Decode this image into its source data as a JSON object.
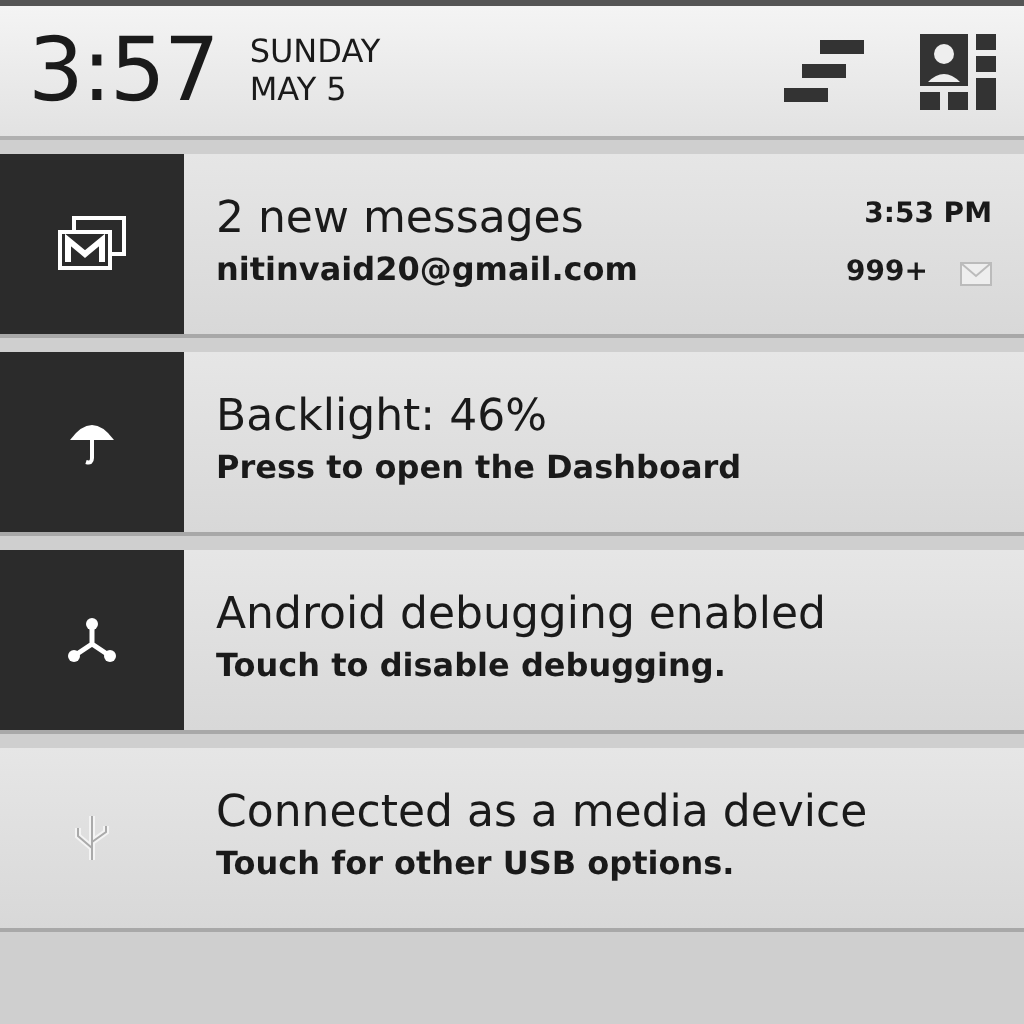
{
  "header": {
    "time": "3:57",
    "day": "SUNDAY",
    "date": "MAY 5"
  },
  "notifications": [
    {
      "kind": "mail",
      "dark_icon": true,
      "title": "2 new messages",
      "subtitle": "nitinvaid20@gmail.com",
      "time": "3:53 PM",
      "count": "999+"
    },
    {
      "kind": "umbrella",
      "dark_icon": true,
      "title": "Backlight: 46%",
      "subtitle": "Press to open the Dashboard"
    },
    {
      "kind": "debug",
      "dark_icon": true,
      "title": "Android debugging enabled",
      "subtitle": "Touch to disable debugging."
    },
    {
      "kind": "usb",
      "dark_icon": false,
      "title": "Connected as a media device",
      "subtitle": "Touch for other USB options."
    }
  ]
}
